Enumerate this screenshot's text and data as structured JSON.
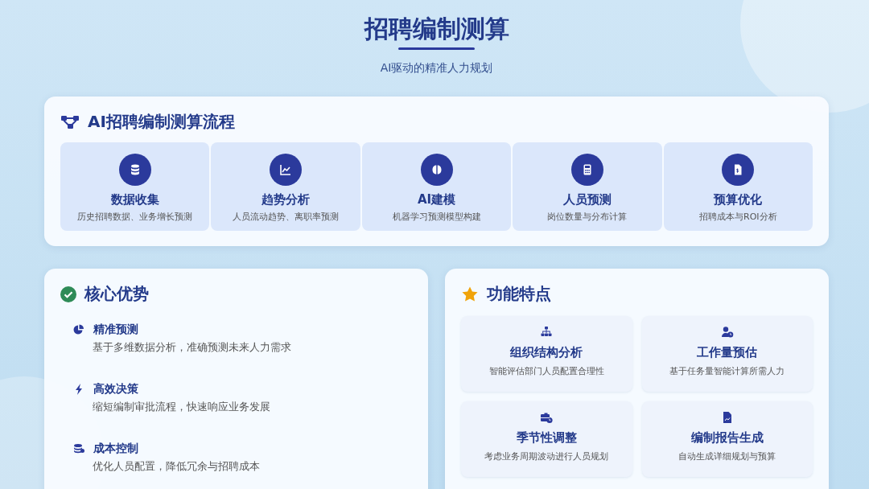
{
  "header": {
    "title": "招聘编制测算",
    "subtitle": "AI驱动的精准人力规划"
  },
  "process": {
    "title": "AI招聘编制测算流程",
    "steps": [
      {
        "kind": "database",
        "title": "数据收集",
        "desc": "历史招聘数据、业务增长预测"
      },
      {
        "kind": "chart",
        "title": "趋势分析",
        "desc": "人员流动趋势、离职率预测"
      },
      {
        "kind": "brain",
        "title": "AI建模",
        "desc": "机器学习预测模型构建"
      },
      {
        "kind": "calculator",
        "title": "人员预测",
        "desc": "岗位数量与分布计算"
      },
      {
        "kind": "invoice",
        "title": "预算优化",
        "desc": "招聘成本与ROI分析"
      }
    ]
  },
  "advantages": {
    "title": "核心优势",
    "items": [
      {
        "kind": "pie",
        "title": "精准预测",
        "desc": "基于多维数据分析，准确预测未来人力需求"
      },
      {
        "kind": "bolt",
        "title": "高效决策",
        "desc": "缩短编制审批流程，快速响应业务发展"
      },
      {
        "kind": "coins",
        "title": "成本控制",
        "desc": "优化人员配置，降低冗余与招聘成本"
      }
    ]
  },
  "features": {
    "title": "功能特点",
    "items": [
      {
        "kind": "org",
        "title": "组织结构分析",
        "desc": "智能评估部门人员配置合理性"
      },
      {
        "kind": "userclock",
        "title": "工作量预估",
        "desc": "基于任务量智能计算所需人力"
      },
      {
        "kind": "briefcase",
        "title": "季节性调整",
        "desc": "考虑业务周期波动进行人员规划"
      },
      {
        "kind": "report",
        "title": "编制报告生成",
        "desc": "自动生成详细规划与预算"
      }
    ]
  }
}
